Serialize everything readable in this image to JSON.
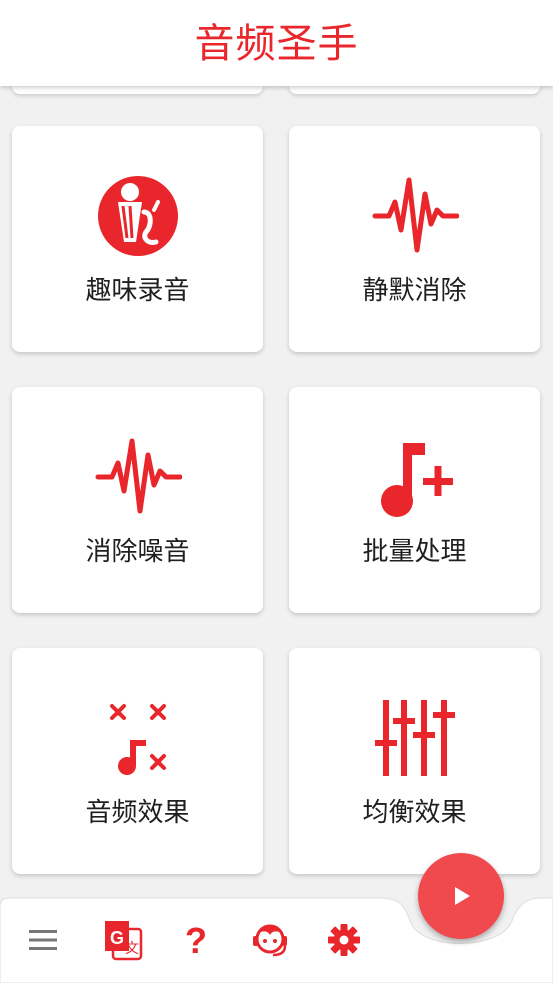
{
  "app": {
    "title": "音频圣手"
  },
  "cards": [
    {
      "label": "趣味录音",
      "icon": "funny-record-icon"
    },
    {
      "label": "静默消除",
      "icon": "silence-removal-icon"
    },
    {
      "label": "消除噪音",
      "icon": "noise-removal-icon"
    },
    {
      "label": "批量处理",
      "icon": "batch-process-icon"
    },
    {
      "label": "音频效果",
      "icon": "audio-effects-icon"
    },
    {
      "label": "均衡效果",
      "icon": "equalizer-icon"
    }
  ],
  "bottom_nav": {
    "items": [
      "menu-icon",
      "translate-icon",
      "help-icon",
      "customer-service-icon",
      "settings-icon"
    ],
    "fab": "play-icon"
  },
  "colors": {
    "accent": "#e8262b",
    "fab": "#f04a4f"
  }
}
